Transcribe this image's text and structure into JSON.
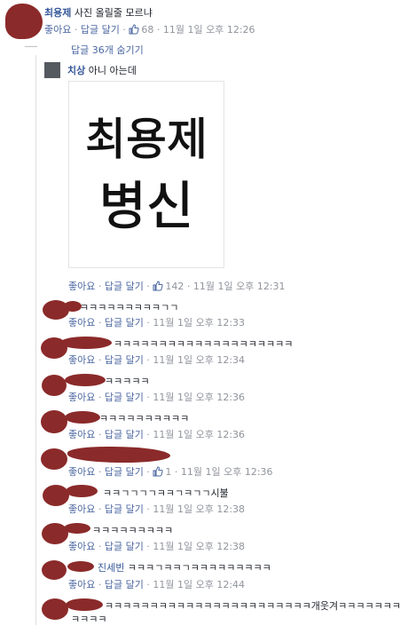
{
  "top_comment": {
    "author": "최용제",
    "text": "사진 올릴줄 모르냐",
    "like_label": "좋아요",
    "reply_label": "답글 달기",
    "likes": "68",
    "time": "11월 1일 오후 12:26"
  },
  "hide_replies_label": "답글 36개 숨기기",
  "reply_main": {
    "author": "치상",
    "text": "아니 아는데",
    "like_label": "좋아요",
    "reply_label": "답글 달기",
    "likes": "142",
    "time": "11월 1일 오후 12:31"
  },
  "replies": [
    {
      "author": "",
      "text": "ㅋㅋㅋㅋㅋㅋㅋㅋㅋㄱㄱ",
      "like_label": "좋아요",
      "reply_label": "답글 달기",
      "likes": "",
      "time": "11월 1일 오후 12:33"
    },
    {
      "author": "",
      "text": "ㅋㅋㅋㅋㅋㅋㅋㅋㅋㅋㅋㅋㅋㅋㅋㅋㅋㅋㅋㅋ",
      "like_label": "좋아요",
      "reply_label": "답글 달기",
      "likes": "",
      "time": "11월 1일 오후 12:34"
    },
    {
      "author": "",
      "text": "ㅋㅋㅋㅋㅋ",
      "like_label": "좋아요",
      "reply_label": "답글 달기",
      "likes": "",
      "time": "11월 1일 오후 12:36"
    },
    {
      "author": "",
      "text": "ㅋㅋㅋㅋㅋㅋㅋㅋㅋㅋ",
      "like_label": "좋아요",
      "reply_label": "답글 달기",
      "likes": "",
      "time": "11월 1일 오후 12:36"
    },
    {
      "author": "",
      "text": "",
      "like_label": "좋아요",
      "reply_label": "답글 달기",
      "likes": "1",
      "time": "11월 1일 오후 12:36"
    },
    {
      "author": "",
      "text": "ㅋㅋㄱㄱㄱㄱㅋㅋㄱㅋㄱㄱ시불",
      "like_label": "좋아요",
      "reply_label": "답글 달기",
      "likes": "",
      "time": "11월 1일 오후 12:38"
    },
    {
      "author": "",
      "text": "ㅋㅋㅋㅋㅋㅋㅋㅋㅋ",
      "like_label": "좋아요",
      "reply_label": "답글 달기",
      "likes": "",
      "time": "11월 1일 오후 12:38"
    },
    {
      "author": "진세빈",
      "text": "ㅋㅋㅋㄱㅋㅋㄱㅋㅋㅋㅋㅋㅋㅋㅋㅋ",
      "like_label": "좋아요",
      "reply_label": "답글 달기",
      "likes": "",
      "time": "11월 1일 오후 12:44"
    },
    {
      "author": "",
      "text": "ㅋㅋㅋㅋㅋㅋㅋㅋㅋㅋㅋㅋㅋㅋㅋㅋㅋㅋㅋㅋㅋㅋㅋ개웃겨ㅋㅋㅋㅋㅋㅋㅋ",
      "text2": "ㅋㅋㅋㅋ",
      "like_label": "",
      "reply_label": "",
      "likes": "",
      "time": ""
    }
  ],
  "image_handwriting": {
    "line1": "최용제",
    "line2": "병신"
  },
  "colors": {
    "link": "#365899",
    "meta": "#90949c",
    "redaction": "#8b2a2a"
  },
  "icons": {
    "like": "thumbs-up-icon",
    "avatar": "profile-picture"
  }
}
